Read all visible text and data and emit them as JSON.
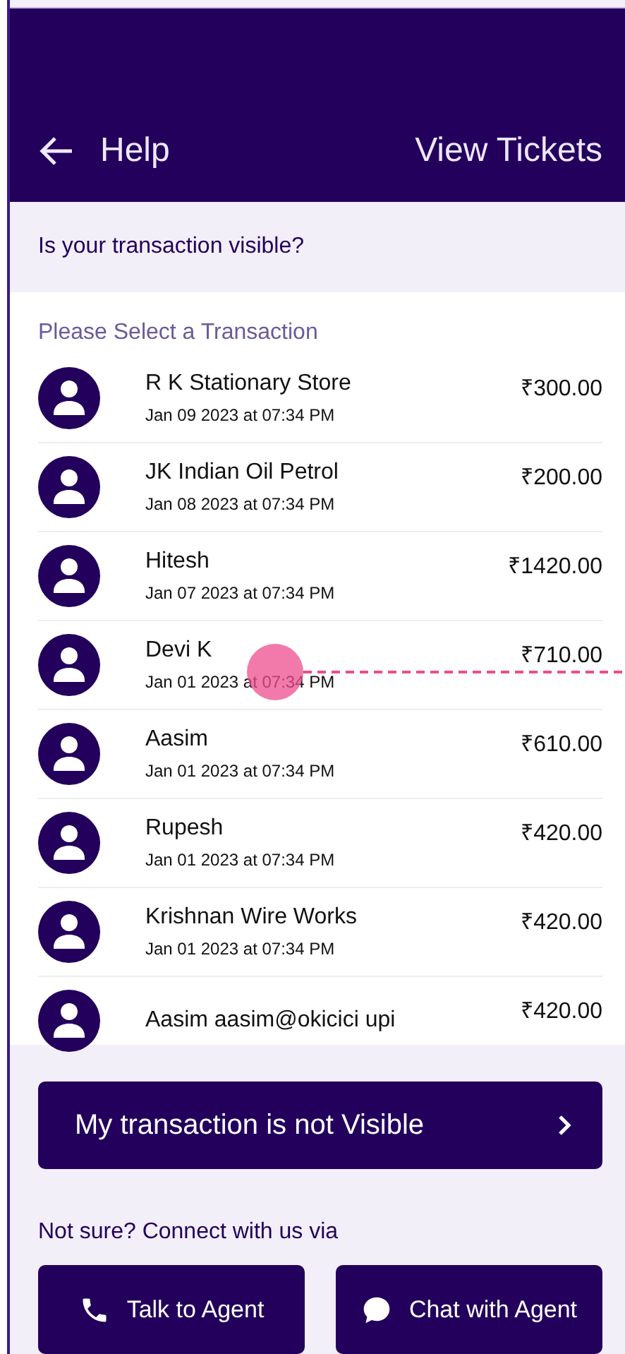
{
  "header": {
    "title": "Help",
    "action": "View Tickets"
  },
  "banner": {
    "text": "Is your transaction visible?"
  },
  "list": {
    "heading": "Please Select a Transaction",
    "transactions": [
      {
        "name": "R K Stationary Store",
        "date": "Jan 09 2023 at 07:34 PM",
        "amount": "₹300.00"
      },
      {
        "name": "JK Indian Oil Petrol",
        "date": "Jan 08 2023 at 07:34 PM",
        "amount": "₹200.00"
      },
      {
        "name": "Hitesh",
        "date": "Jan 07 2023 at 07:34 PM",
        "amount": "₹1420.00"
      },
      {
        "name": "Devi K",
        "date": "Jan 01 2023 at 07:34 PM",
        "amount": "₹710.00"
      },
      {
        "name": "Aasim",
        "date": "Jan 01 2023 at 07:34 PM",
        "amount": "₹610.00"
      },
      {
        "name": "Rupesh",
        "date": "Jan 01 2023 at 07:34 PM",
        "amount": "₹420.00"
      },
      {
        "name": "Krishnan Wire Works",
        "date": "Jan 01 2023 at 07:34 PM",
        "amount": "₹420.00"
      },
      {
        "name": "Aasim aasim@okicici upi",
        "amount": "₹420.00"
      }
    ]
  },
  "not_visible_button": {
    "label": "My transaction is not Visible"
  },
  "connect": {
    "text": "Not sure? Connect with us via",
    "buttons": [
      {
        "kind": "phone",
        "label": "Talk to Agent"
      },
      {
        "kind": "chat",
        "label": "Chat with Agent"
      }
    ]
  }
}
